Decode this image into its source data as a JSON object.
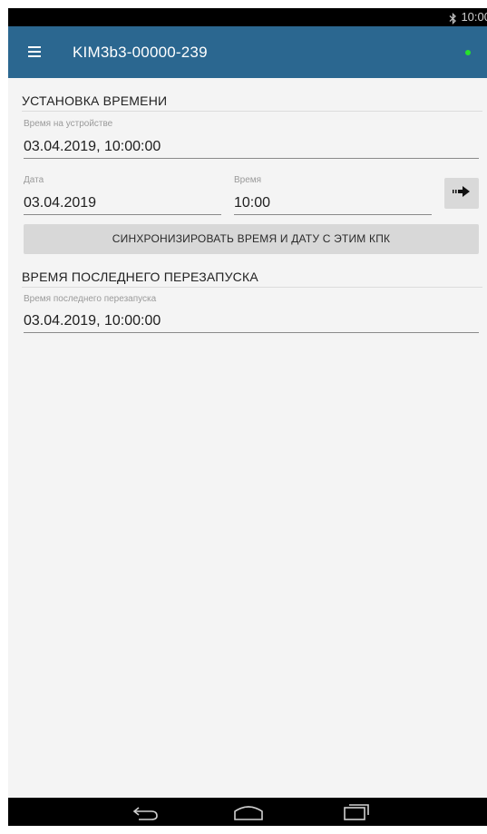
{
  "status_bar": {
    "time": "10:00",
    "bluetooth_icon": "bluetooth-icon"
  },
  "app_bar": {
    "menu_icon": "menu-icon",
    "title": "KIM3b3-00000-239",
    "status_indicator_color": "#27e22b"
  },
  "time_setting": {
    "header": "УСТАНОВКА ВРЕМЕНИ",
    "device_time": {
      "label": "Время на устройстве",
      "value": "03.04.2019, 10:00:00"
    },
    "date": {
      "label": "Дата",
      "value": "03.04.2019"
    },
    "time": {
      "label": "Время",
      "value": "10:00"
    },
    "apply_icon": "arrow-right-icon",
    "sync_button_label": "СИНХРОНИЗИРОВАТЬ ВРЕМЯ И ДАТУ С ЭТИМ КПК"
  },
  "last_restart": {
    "header": "ВРЕМЯ ПОСЛЕДНЕГО ПЕРЕЗАПУСКА",
    "label": "Время последнего перезапуска",
    "value": "03.04.2019, 10:00:00"
  },
  "nav_bar": {
    "back_icon": "back-icon",
    "home_icon": "home-icon",
    "recents_icon": "recents-icon"
  },
  "colors": {
    "app_bar": "#2b6790",
    "background": "#f4f4f4",
    "button": "#d8d8d8"
  }
}
